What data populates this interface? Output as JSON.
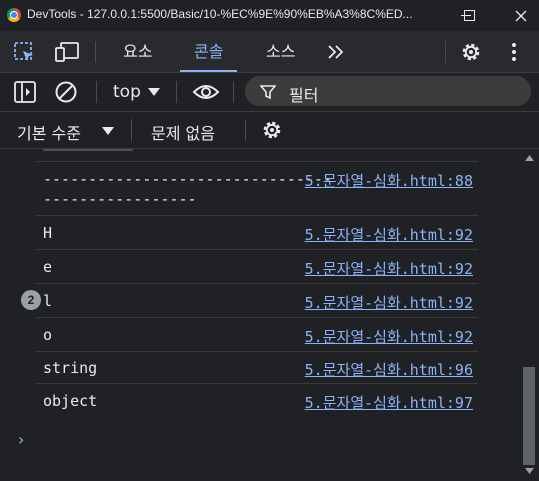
{
  "window": {
    "title": "DevTools - 127.0.0.1:5500/Basic/10-%EC%9E%90%EB%A3%8C%ED..."
  },
  "tabs": [
    {
      "label": "요소",
      "active": false
    },
    {
      "label": "콘솔",
      "active": true
    },
    {
      "label": "소스",
      "active": false
    }
  ],
  "toolbar": {
    "context": "top",
    "filter_placeholder": "필터",
    "level": "기본 수준",
    "issues": "문제 없음"
  },
  "console": {
    "rows": [
      {
        "message": "--------------------------------",
        "message_wrap": "-----------------",
        "source": "5.문자열-심화.html:88"
      },
      {
        "message": "H",
        "source": "5.문자열-심화.html:92"
      },
      {
        "message": "e",
        "source": "5.문자열-심화.html:92"
      },
      {
        "message": "l",
        "source": "5.문자열-심화.html:92",
        "repeat": "2"
      },
      {
        "message": "o",
        "source": "5.문자열-심화.html:92"
      },
      {
        "message": "string",
        "source": "5.문자열-심화.html:96"
      },
      {
        "message": "object",
        "source": "5.문자열-심화.html:97"
      }
    ],
    "prompt_symbol": "›"
  },
  "colors": {
    "accent": "#8ab4f8",
    "background": "#202124",
    "toolbar": "#292a2d"
  }
}
